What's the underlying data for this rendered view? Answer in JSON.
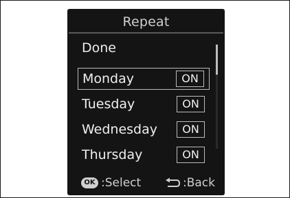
{
  "screen": {
    "title": "Repeat",
    "done_label": "Done",
    "days": [
      {
        "label": "Monday",
        "value": "ON",
        "selected": true
      },
      {
        "label": "Tuesday",
        "value": "ON",
        "selected": false
      },
      {
        "label": "Wednesday",
        "value": "ON",
        "selected": false
      },
      {
        "label": "Thursday",
        "value": "ON",
        "selected": false
      }
    ],
    "footer": {
      "ok_icon_label": "OK",
      "select_hint": ":Select",
      "back_hint": ":Back"
    }
  },
  "icons": {
    "ok_button": "ok-button-icon",
    "back_arrow": "back-arrow-icon"
  },
  "colors": {
    "screen_background": "#141414",
    "text": "#efefef",
    "outline": "#bdbdbd"
  }
}
